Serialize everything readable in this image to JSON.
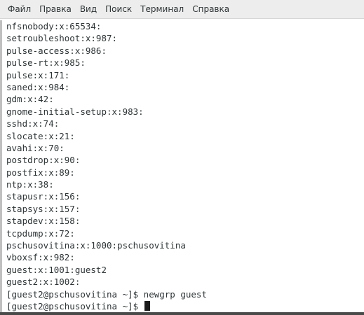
{
  "menubar": {
    "items": [
      "Файл",
      "Правка",
      "Вид",
      "Поиск",
      "Терминал",
      "Справка"
    ]
  },
  "terminal": {
    "lines": [
      "nfsnobody:x:65534:",
      "setroubleshoot:x:987:",
      "pulse-access:x:986:",
      "pulse-rt:x:985:",
      "pulse:x:171:",
      "saned:x:984:",
      "gdm:x:42:",
      "gnome-initial-setup:x:983:",
      "sshd:x:74:",
      "slocate:x:21:",
      "avahi:x:70:",
      "postdrop:x:90:",
      "postfix:x:89:",
      "ntp:x:38:",
      "stapusr:x:156:",
      "stapsys:x:157:",
      "stapdev:x:158:",
      "tcpdump:x:72:",
      "pschusovitina:x:1000:pschusovitina",
      "vboxsf:x:982:",
      "guest:x:1001:guest2",
      "guest2:x:1002:",
      "[guest2@pschusovitina ~]$ newgrp guest"
    ],
    "prompt": "[guest2@pschusovitina ~]$ "
  }
}
